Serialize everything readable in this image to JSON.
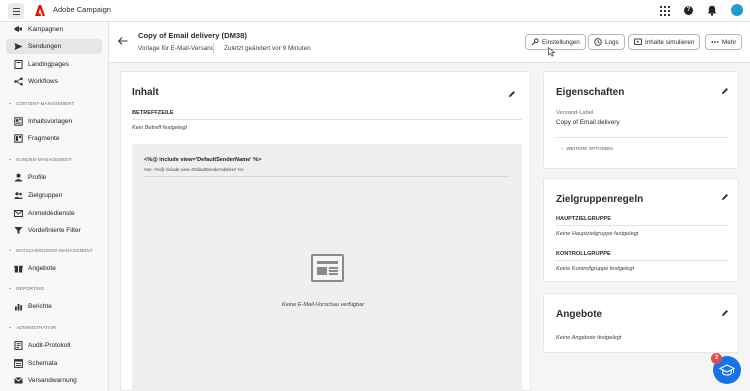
{
  "topbar": {
    "app_name": "Adobe Campaign",
    "help_symbol": "?",
    "icons": [
      "menu-icon",
      "adobe-logo",
      "apps-grid-icon",
      "help-icon",
      "bell-icon",
      "avatar"
    ]
  },
  "sidebar": {
    "items_top": [
      {
        "label": "Kampagnen",
        "icon": "campaign-icon"
      },
      {
        "label": "Sendungen",
        "icon": "send-icon",
        "active": true
      },
      {
        "label": "Landingpages",
        "icon": "page-icon"
      },
      {
        "label": "Workflows",
        "icon": "workflow-icon"
      }
    ],
    "sections": [
      {
        "title": "CONTENT-MANAGEMENT",
        "items": [
          {
            "label": "Inhaltsvorlagen",
            "icon": "template-icon"
          },
          {
            "label": "Fragmente",
            "icon": "fragment-icon"
          }
        ]
      },
      {
        "title": "KUNDEN-MANAGEMENT",
        "items": [
          {
            "label": "Profile",
            "icon": "profile-icon"
          },
          {
            "label": "Zielgruppen",
            "icon": "audience-icon"
          },
          {
            "label": "Anmeldedienste",
            "icon": "subscription-icon"
          },
          {
            "label": "Vordefinierte Filter",
            "icon": "filter-icon"
          }
        ]
      },
      {
        "title": "ENTSCHEIDUNGS-MANAGEMENT",
        "items": [
          {
            "label": "Angebote",
            "icon": "offer-icon"
          }
        ]
      },
      {
        "title": "REPORTING",
        "items": [
          {
            "label": "Berichte",
            "icon": "report-icon"
          }
        ]
      },
      {
        "title": "ADMINISTRATION",
        "items": [
          {
            "label": "Audit-Protokoll",
            "icon": "audit-icon"
          },
          {
            "label": "Schemata",
            "icon": "schema-icon"
          },
          {
            "label": "Versandwarnung",
            "icon": "warning-icon"
          }
        ]
      }
    ]
  },
  "header": {
    "title": "Copy of Email delivery (DM38)",
    "template": "Vorlage für E-Mail-Versand",
    "modified": "Zuletzt geändert vor 9 Minuten",
    "buttons": {
      "settings": "Einstellungen",
      "logs": "Logs",
      "simulate": "Inhalte simulieren",
      "more": "Mehr"
    }
  },
  "content_card": {
    "title": "Inhalt",
    "subject_label": "BETREFFZEILE",
    "subject_value": "Kein Betreff festgelegt",
    "sender_name": "<%@ include view='DefaultSenderName' %>",
    "sender_address": "Von: <%@ include view='DefaultSenderAddress' %>",
    "no_preview": "Keine E-Mail-Vorschau verfügbar"
  },
  "properties_card": {
    "title": "Eigenschaften",
    "label_caption": "Versand-Label",
    "label_value": "Copy of Email delivery",
    "more_options": "WEITERE OPTIONEN"
  },
  "audience_card": {
    "title": "Zielgruppenregeln",
    "main_label": "HAUPTZIELGRUPPE",
    "main_value": "Keine Hauptzielgruppe festgelegt",
    "control_label": "KONTROLLGRUPPE",
    "control_value": "Keine Kontrollgruppe festgelegt"
  },
  "offers_card": {
    "title": "Angebote",
    "value": "Keine Angebote festgelegt"
  },
  "fab": {
    "badge": "2",
    "icon": "learn-icon"
  },
  "colors": {
    "accent": "#1473e6",
    "badge": "#e34850",
    "adobe_red": "#eb1000"
  }
}
